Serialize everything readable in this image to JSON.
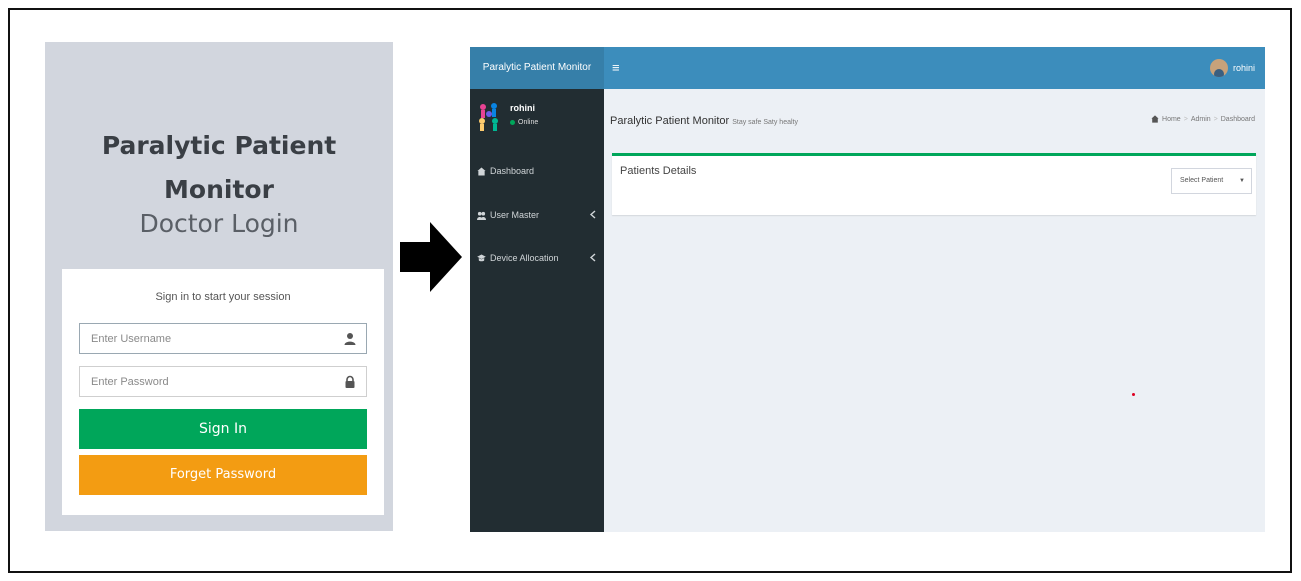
{
  "login": {
    "title_line1": "Paralytic Patient",
    "title_line2": "Monitor",
    "subtitle": "Doctor Login",
    "session_message": "Sign in to start your session",
    "username_placeholder": "Enter Username",
    "password_placeholder": "Enter Password",
    "username_icon": "user-icon",
    "password_icon": "lock-icon",
    "signin_label": "Sign In",
    "forget_label": "Forget Password"
  },
  "dashboard": {
    "brand": "Paralytic Patient Monitor",
    "menu_icon": "≡",
    "top_username": "rohini",
    "sidebar": {
      "user_name": "rohini",
      "status": "Online",
      "items": [
        {
          "label": "Dashboard",
          "icon": "dashboard-icon",
          "has_chevron": false
        },
        {
          "label": "User Master",
          "icon": "users-icon",
          "has_chevron": true
        },
        {
          "label": "Device Allocation",
          "icon": "device-icon",
          "has_chevron": true
        }
      ]
    },
    "header": {
      "title": "Paralytic Patient Monitor",
      "subtitle": "Stay safe Saty healty"
    },
    "breadcrumb": [
      "Home",
      "Admin",
      "Dashboard"
    ],
    "card": {
      "title": "Patients Details",
      "select_value": "Select Patient"
    }
  },
  "colors": {
    "login_bg": "#d2d6de",
    "signin": "#00a65a",
    "forget": "#f39c12",
    "topbar": "#3c8dbc",
    "brand_bg": "#367fa9",
    "sidebar": "#222d32",
    "content_bg": "#ecf0f5"
  }
}
